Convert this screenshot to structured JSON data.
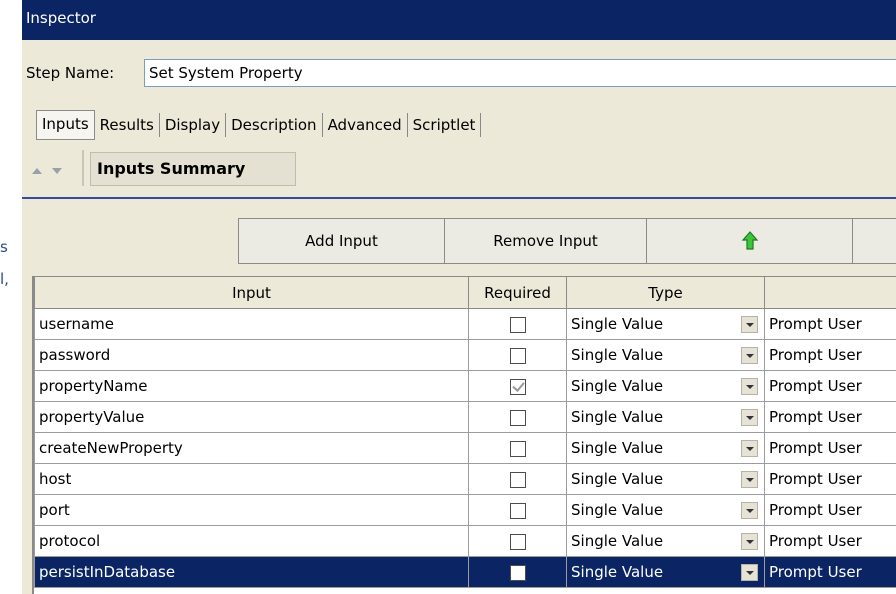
{
  "window": {
    "title": "Inspector"
  },
  "step": {
    "label": "Step Name:",
    "value": "Set System Property"
  },
  "tabs": [
    "Inputs",
    "Results",
    "Display",
    "Description",
    "Advanced",
    "Scriptlet"
  ],
  "active_tab": "Inputs",
  "section": {
    "title": "Inputs Summary"
  },
  "toolbar": {
    "add_label": "Add Input",
    "remove_label": "Remove Input"
  },
  "grid": {
    "columns": [
      "Input",
      "Required",
      "Type",
      ""
    ],
    "rows": [
      {
        "input": "username",
        "required": false,
        "type": "Single Value",
        "from": "Prompt User"
      },
      {
        "input": "password",
        "required": false,
        "type": "Single Value",
        "from": "Prompt User"
      },
      {
        "input": "propertyName",
        "required": true,
        "type": "Single Value",
        "from": "Prompt User"
      },
      {
        "input": "propertyValue",
        "required": false,
        "type": "Single Value",
        "from": "Prompt User"
      },
      {
        "input": "createNewProperty",
        "required": false,
        "type": "Single Value",
        "from": "Prompt User"
      },
      {
        "input": "host",
        "required": false,
        "type": "Single Value",
        "from": "Prompt User"
      },
      {
        "input": "port",
        "required": false,
        "type": "Single Value",
        "from": "Prompt User"
      },
      {
        "input": "protocol",
        "required": false,
        "type": "Single Value",
        "from": "Prompt User"
      },
      {
        "input": "persistInDatabase",
        "required": false,
        "type": "Single Value",
        "from": "Prompt User"
      }
    ],
    "selected_row": 8
  },
  "colors": {
    "title_bar": "#0b2463",
    "selection": "#0b2463",
    "panel_bg": "#ece9d8",
    "up_arrow": "#3cc43c"
  },
  "icons": {
    "move_up": "green-up-arrow-icon",
    "nav": [
      "collapse-up-icon",
      "expand-down-icon"
    ]
  }
}
